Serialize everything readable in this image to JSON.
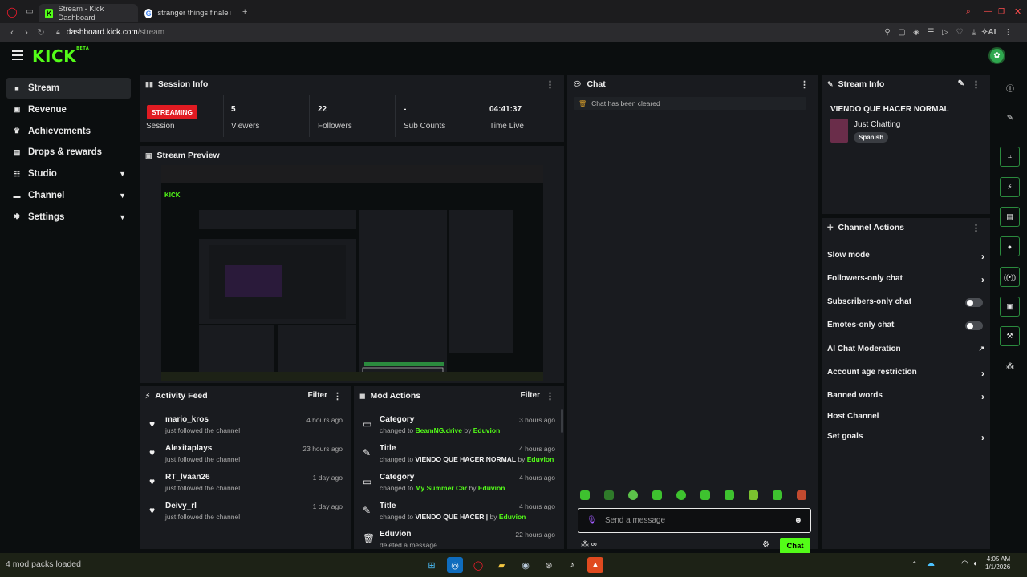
{
  "browser": {
    "tabs": [
      {
        "title": "Stream - Kick Dashboard",
        "active": true
      },
      {
        "title": "stranger things finale rele",
        "active": false
      }
    ],
    "url_host": "dashboard.kick.com",
    "url_path": "/stream",
    "ai_label": "AI"
  },
  "app": {
    "logo": "KICK",
    "logo_badge": "BETA",
    "accent": "#53fc18"
  },
  "sidebar": {
    "items": [
      {
        "label": "Stream",
        "icon": "video-icon",
        "active": true
      },
      {
        "label": "Revenue",
        "icon": "dollar-icon"
      },
      {
        "label": "Achievements",
        "icon": "trophy-icon"
      },
      {
        "label": "Drops & rewards",
        "icon": "gift-icon"
      },
      {
        "label": "Studio",
        "icon": "sliders-icon",
        "expandable": true
      },
      {
        "label": "Channel",
        "icon": "tv-icon",
        "expandable": true
      },
      {
        "label": "Settings",
        "icon": "gear-icon",
        "expandable": true
      }
    ]
  },
  "session_info": {
    "title": "Session Info",
    "status_badge": "STREAMING",
    "status_color": "#e11b22",
    "stats": [
      {
        "value": "",
        "label": "Session"
      },
      {
        "value": "5",
        "label": "Viewers"
      },
      {
        "value": "22",
        "label": "Followers"
      },
      {
        "value": "-",
        "label": "Sub Counts"
      },
      {
        "value": "04:41:37",
        "label": "Time Live"
      }
    ]
  },
  "stream_preview": {
    "title": "Stream Preview"
  },
  "activity_feed": {
    "title": "Activity Feed",
    "filter_label": "Filter",
    "items": [
      {
        "name": "mario_kros",
        "text": "just followed the channel",
        "time": "4 hours ago"
      },
      {
        "name": "Alexitaplays",
        "text": "just followed the channel",
        "time": "23 hours ago"
      },
      {
        "name": "RT_lvaan26",
        "text": "just followed the channel",
        "time": "1 day ago"
      },
      {
        "name": "Deivy_rl",
        "text": "just followed the channel",
        "time": "1 day ago"
      }
    ]
  },
  "mod_actions": {
    "title": "Mod Actions",
    "filter_label": "Filter",
    "items": [
      {
        "title": "Category",
        "prefix": "changed to ",
        "value": "BeamNG.drive",
        "by": " by ",
        "user": "Eduvion",
        "time": "3 hours ago"
      },
      {
        "title": "Title",
        "prefix": "changed to ",
        "value": "VIENDO QUE HACER NORMAL",
        "by": " by ",
        "user": "Eduvion",
        "time": "4 hours ago"
      },
      {
        "title": "Category",
        "prefix": "changed to ",
        "value": "My Summer Car",
        "by": " by ",
        "user": "Eduvion",
        "time": "4 hours ago"
      },
      {
        "title": "Title",
        "prefix": "changed to ",
        "value": "VIENDO QUE HACER |",
        "by": " by ",
        "user": "Eduvion",
        "time": "4 hours ago"
      },
      {
        "title": "Eduvion",
        "prefix": "deleted a message",
        "value": "",
        "by": "",
        "user": "",
        "time": "22 hours ago"
      }
    ]
  },
  "chat": {
    "title": "Chat",
    "cleared_notice": "Chat has been cleared",
    "input_placeholder": "Send a message",
    "send_label": "Chat"
  },
  "stream_info": {
    "title": "Stream Info",
    "stream_title": "VIENDO QUE HACER NORMAL",
    "category": "Just Chatting",
    "language_tag": "Spanish"
  },
  "channel_actions": {
    "title": "Channel Actions",
    "items": [
      {
        "label": "Slow mode",
        "control": "chevron"
      },
      {
        "label": "Followers-only chat",
        "control": "chevron"
      },
      {
        "label": "Subscribers-only chat",
        "control": "toggle"
      },
      {
        "label": "Emotes-only chat",
        "control": "toggle"
      },
      {
        "label": "AI Chat Moderation",
        "control": "external"
      },
      {
        "label": "Account age restriction",
        "control": "chevron"
      },
      {
        "label": "Banned words",
        "control": "chevron"
      },
      {
        "label": "Host Channel",
        "control": "none"
      },
      {
        "label": "Set goals",
        "control": "chevron"
      }
    ]
  },
  "taskbar": {
    "status_text": "4 mod packs loaded",
    "time": "4:05 AM",
    "date": "1/1/2026"
  }
}
